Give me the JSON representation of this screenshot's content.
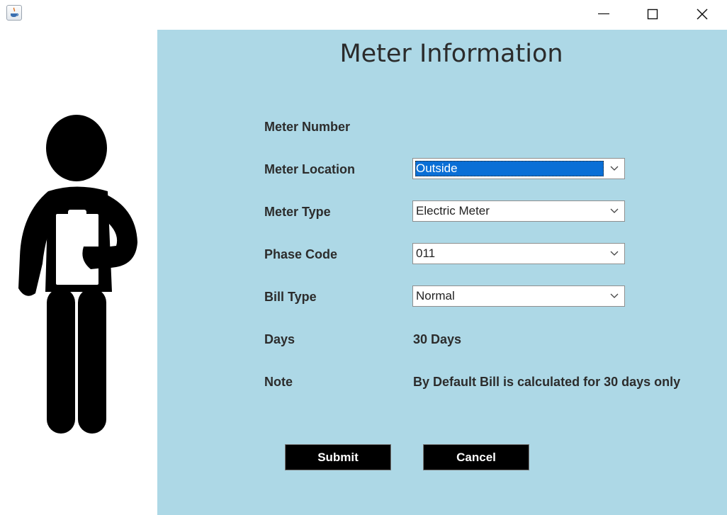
{
  "window": {
    "minimize_icon": "minimize-icon",
    "maximize_icon": "maximize-icon",
    "close_icon": "close-icon"
  },
  "form": {
    "title": "Meter Information",
    "labels": {
      "meter_number": "Meter Number",
      "meter_location": "Meter Location",
      "meter_type": "Meter Type",
      "phase_code": "Phase Code",
      "bill_type": "Bill Type",
      "days": "Days",
      "note": "Note"
    },
    "fields": {
      "meter_number_value": "",
      "meter_location_value": "Outside",
      "meter_type_value": "Electric Meter",
      "phase_code_value": "011",
      "bill_type_value": "Normal",
      "days_value": "30 Days",
      "note_value": "By Default Bill is calculated for 30 days only"
    },
    "buttons": {
      "submit": "Submit",
      "cancel": "Cancel"
    }
  },
  "colors": {
    "panel_background": "#add8e6",
    "selection": "#0a6fd6",
    "button_background": "#000000"
  }
}
